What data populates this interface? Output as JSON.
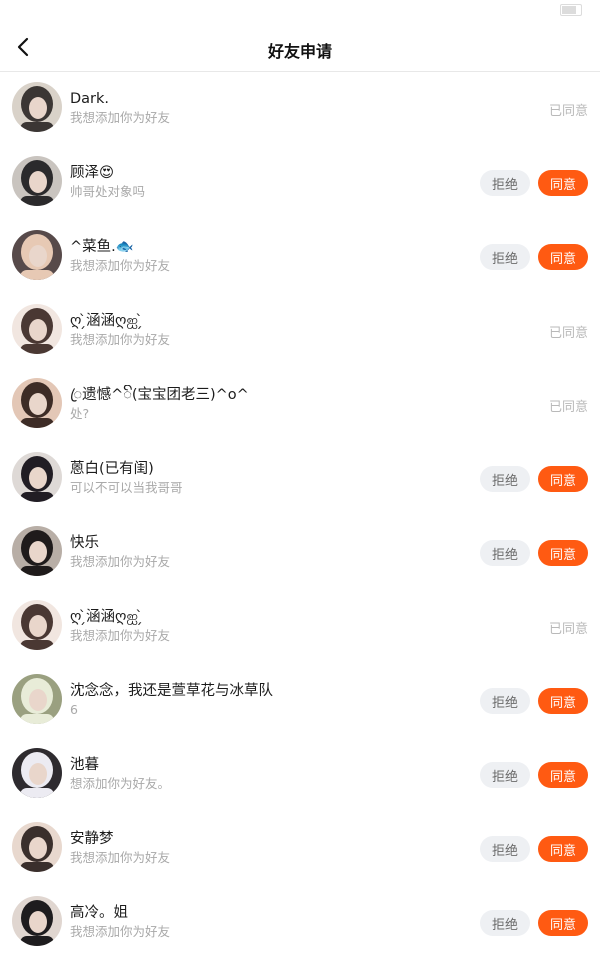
{
  "header": {
    "title": "好友申请"
  },
  "requests": [
    {
      "name": "Dark.",
      "message": "我想添加你为好友",
      "status": "agreed",
      "status_label": "已同意",
      "avatar_colors": [
        "#3b3634",
        "#d9d2c9"
      ]
    },
    {
      "name": "顾泽😍",
      "message": "帅哥处对象吗",
      "status": "pending",
      "avatar_colors": [
        "#2b2a2c",
        "#c9c4bf"
      ]
    },
    {
      "name": "^菜鱼.🐟",
      "message": "我想添加你为好友",
      "status": "pending",
      "avatar_colors": [
        "#e7c9b4",
        "#574a4a"
      ]
    },
    {
      "name": "ღ ̗̀涵涵ღஐ ̗̀",
      "message": "我想添加你为好友",
      "status": "agreed",
      "status_label": "已同意",
      "avatar_colors": [
        "#4a3833",
        "#f1e6e0"
      ]
    },
    {
      "name": "ꦿ遗憾^ꦼ(宝宝团老三)^o^",
      "message": "处?",
      "status": "agreed",
      "status_label": "已同意",
      "avatar_colors": [
        "#3d2c26",
        "#e3c7b6"
      ]
    },
    {
      "name": "蒽白(已有闺)",
      "message": "可以不可以当我哥哥",
      "status": "pending",
      "avatar_colors": [
        "#211d24",
        "#ded9d6"
      ]
    },
    {
      "name": "快乐",
      "message": "我想添加你为好友",
      "status": "pending",
      "avatar_colors": [
        "#1f1b1b",
        "#b8aea6"
      ]
    },
    {
      "name": "ღ ̗̀涵涵ღஐ ̗̀",
      "message": "我想添加你为好友",
      "status": "agreed",
      "status_label": "已同意",
      "avatar_colors": [
        "#4a3833",
        "#f1e6e0"
      ]
    },
    {
      "name": "沈念念，我还是萱草花与冰草队",
      "message": "6",
      "status": "pending",
      "avatar_colors": [
        "#e8ecd8",
        "#9aa080"
      ]
    },
    {
      "name": "池暮",
      "message": "想添加你为好友。",
      "status": "pending",
      "avatar_colors": [
        "#ecebf2",
        "#2e2b2f"
      ]
    },
    {
      "name": "安静梦",
      "message": "我想添加你为好友",
      "status": "pending",
      "avatar_colors": [
        "#3a2f2c",
        "#e8d8ce"
      ]
    },
    {
      "name": "高冷。姐",
      "message": "我想添加你为好友",
      "status": "pending",
      "avatar_colors": [
        "#1e1c1e",
        "#e0d6d0"
      ]
    }
  ],
  "labels": {
    "reject": "拒绝",
    "accept": "同意"
  },
  "colors": {
    "accent": "#ff5a12",
    "reject_bg": "#eef0f3",
    "muted_text": "#a9a9a9"
  },
  "icons": {
    "back": "chevron-left-icon"
  }
}
